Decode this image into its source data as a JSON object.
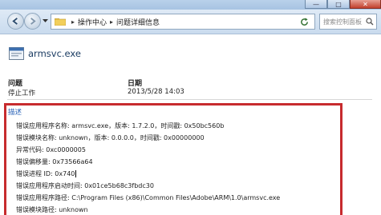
{
  "window": {
    "controls": [
      "—",
      "□",
      "✕"
    ]
  },
  "nav": {
    "breadcrumb": [
      "操作中心",
      "问题详细信息"
    ],
    "search_placeholder": "搜索控制面板"
  },
  "app": {
    "name": "armsvc.exe"
  },
  "summary": {
    "problem_label": "问题",
    "problem_value": "停止工作",
    "date_label": "日期",
    "date_value": "2013/5/28 14:03"
  },
  "details": {
    "label": "描述",
    "lines": [
      "错误应用程序名称: armsvc.exe，版本: 1.7.2.0，时间戳: 0x50bc560b",
      "错误模块名称: unknown，版本: 0.0.0.0，时间戳: 0x00000000",
      "异常代码: 0xc0000005",
      "错误偏移量: 0x73566a64",
      "错误进程 ID: 0x740",
      "错误应用程序启动时间: 0x01ce5b68c3fbdc30",
      "错误应用程序路径: C:\\Program Files (x86)\\Common Files\\Adobe\\ARM\\1.0\\armsvc.exe",
      "错误模块路径: unknown"
    ]
  },
  "colors": {
    "highlight_border": "#c72b2e",
    "link_blue": "#2a63b8"
  },
  "icons": [
    "back-arrow-icon",
    "forward-arrow-icon",
    "chevron-down-icon",
    "folder-icon",
    "refresh-icon",
    "search-icon",
    "app-window-icon"
  ]
}
